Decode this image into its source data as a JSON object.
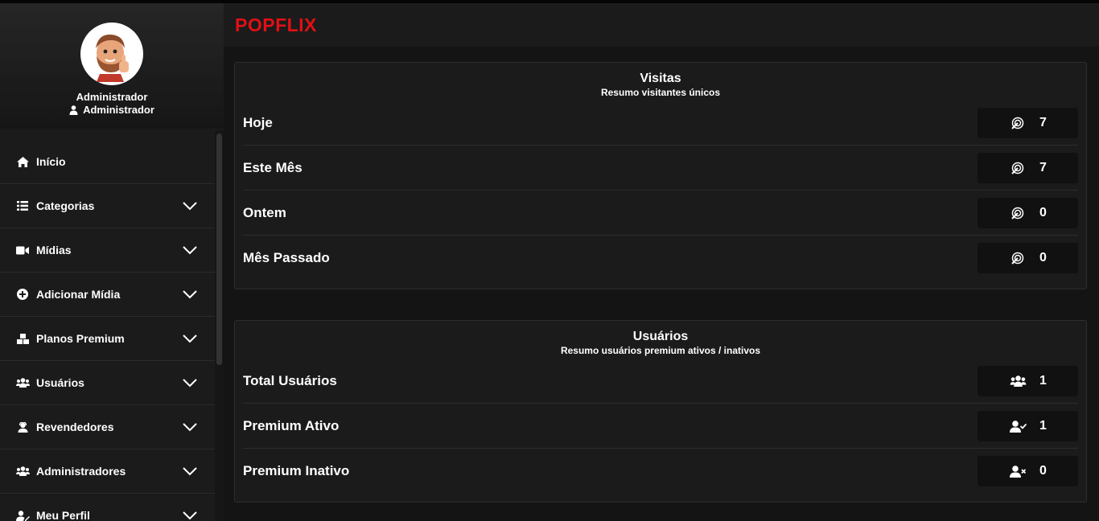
{
  "brand": "POPFLIX",
  "profile": {
    "name": "Administrador",
    "role": "Administrador",
    "avatar_icon": "avatar-bearded-man-thumbs-up"
  },
  "sidebar": {
    "items": [
      {
        "label": "Início",
        "icon": "home-icon",
        "has_chevron": false
      },
      {
        "label": "Categorias",
        "icon": "list-icon",
        "has_chevron": true
      },
      {
        "label": "Mídias",
        "icon": "video-camera-icon",
        "has_chevron": true
      },
      {
        "label": "Adicionar Mídia",
        "icon": "plus-circle-icon",
        "has_chevron": true
      },
      {
        "label": "Planos Premium",
        "icon": "boxes-icon",
        "has_chevron": true
      },
      {
        "label": "Usuários",
        "icon": "users-icon",
        "has_chevron": true
      },
      {
        "label": "Revendedores",
        "icon": "user-headset-icon",
        "has_chevron": true
      },
      {
        "label": "Administradores",
        "icon": "users-icon",
        "has_chevron": true
      },
      {
        "label": "Meu Perfil",
        "icon": "user-edit-icon",
        "has_chevron": true
      }
    ]
  },
  "visits": {
    "title": "Visitas",
    "subtitle": "Resumo visitantes únicos",
    "rows": [
      {
        "label": "Hoje",
        "value": "7",
        "icon": "tracking-icon"
      },
      {
        "label": "Este Mês",
        "value": "7",
        "icon": "tracking-icon"
      },
      {
        "label": "Ontem",
        "value": "0",
        "icon": "tracking-icon"
      },
      {
        "label": "Mês Passado",
        "value": "0",
        "icon": "tracking-icon"
      }
    ]
  },
  "users": {
    "title": "Usuários",
    "subtitle": "Resumo usuários premium ativos / inativos",
    "rows": [
      {
        "label": "Total Usuários",
        "value": "1",
        "icon": "users-icon"
      },
      {
        "label": "Premium Ativo",
        "value": "1",
        "icon": "user-check-icon"
      },
      {
        "label": "Premium Inativo",
        "value": "0",
        "icon": "user-times-icon"
      }
    ]
  },
  "colors": {
    "brand": "#e01015",
    "panel": "#1b1b1b",
    "background": "#141414"
  }
}
